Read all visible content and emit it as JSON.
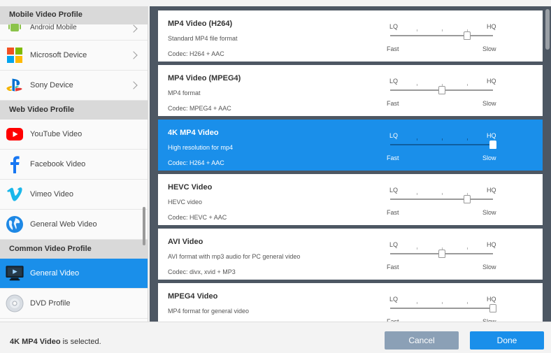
{
  "sidebar": {
    "groups": [
      {
        "header": "Mobile Video Profile",
        "items": [
          {
            "label": "Android Mobile",
            "icon": "android-icon"
          },
          {
            "label": "Microsoft Device",
            "icon": "microsoft-icon"
          },
          {
            "label": "Sony Device",
            "icon": "playstation-icon"
          }
        ]
      },
      {
        "header": "Web Video Profile",
        "items": [
          {
            "label": "YouTube Video",
            "icon": "youtube-icon"
          },
          {
            "label": "Facebook Video",
            "icon": "facebook-icon"
          },
          {
            "label": "Vimeo Video",
            "icon": "vimeo-icon"
          },
          {
            "label": "General Web Video",
            "icon": "globe-icon"
          }
        ]
      },
      {
        "header": "Common Video Profile",
        "items": [
          {
            "label": "General Video",
            "icon": "monitor-icon",
            "selected": true
          },
          {
            "label": "DVD Profile",
            "icon": "disc-icon"
          }
        ]
      }
    ]
  },
  "profiles": [
    {
      "title": "MP4 Video (H264)",
      "desc": "Standard MP4 file format",
      "codec": "Codec: H264 + AAC",
      "lq": "LQ",
      "hq": "HQ",
      "fast": "Fast",
      "slow": "Slow",
      "quality": 0.75
    },
    {
      "title": "MP4 Video (MPEG4)",
      "desc": "MP4 format",
      "codec": "Codec: MPEG4 + AAC",
      "lq": "LQ",
      "hq": "HQ",
      "fast": "Fast",
      "slow": "Slow",
      "quality": 0.5
    },
    {
      "title": "4K MP4 Video",
      "desc": "High resolution for mp4",
      "codec": "Codec: H264 + AAC",
      "lq": "LQ",
      "hq": "HQ",
      "fast": "Fast",
      "slow": "Slow",
      "quality": 1.0,
      "selected": true
    },
    {
      "title": "HEVC Video",
      "desc": "HEVC video",
      "codec": "Codec: HEVC + AAC",
      "lq": "LQ",
      "hq": "HQ",
      "fast": "Fast",
      "slow": "Slow",
      "quality": 0.75
    },
    {
      "title": "AVI Video",
      "desc": "AVI format with mp3 audio for PC general video",
      "codec": "Codec: divx, xvid + MP3",
      "lq": "LQ",
      "hq": "HQ",
      "fast": "Fast",
      "slow": "Slow",
      "quality": 0.5
    },
    {
      "title": "MPEG4 Video",
      "desc": "MP4 format for general video",
      "codec": "",
      "lq": "LQ",
      "hq": "HQ",
      "fast": "Fast",
      "slow": "Slow",
      "quality": 1.0
    }
  ],
  "footer": {
    "selected_name": "4K MP4 Video",
    "status_suffix": " is selected.",
    "cancel_label": "Cancel",
    "done_label": "Done"
  },
  "colors": {
    "accent": "#1a8fea",
    "panel_bg": "#4d5763",
    "cancel": "#8ba0b6"
  }
}
